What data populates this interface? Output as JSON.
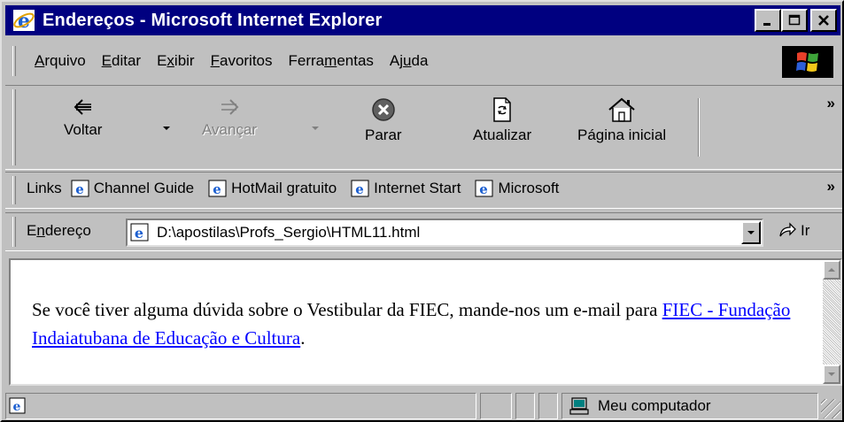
{
  "window": {
    "title": "Endereços - Microsoft Internet Explorer",
    "controls": {
      "minimize": "_",
      "maximize": "□",
      "close": "×"
    }
  },
  "menu": [
    {
      "pre": "",
      "key": "A",
      "post": "rquivo"
    },
    {
      "pre": "",
      "key": "E",
      "post": "ditar"
    },
    {
      "pre": "E",
      "key": "x",
      "post": "ibir"
    },
    {
      "pre": "",
      "key": "F",
      "post": "avoritos"
    },
    {
      "pre": "Ferra",
      "key": "m",
      "post": "entas"
    },
    {
      "pre": "Aj",
      "key": "u",
      "post": "da"
    }
  ],
  "toolbar": {
    "back_label": "Voltar",
    "forward_label": "Avançar",
    "stop_label": "Parar",
    "refresh_label": "Atualizar",
    "home_label": "Página inicial",
    "more": "»"
  },
  "links": {
    "label": "Links",
    "items": [
      "Channel Guide",
      "HotMail gratuito",
      "Internet Start",
      "Microsoft"
    ],
    "more": "»"
  },
  "address": {
    "label_pre": "E",
    "label_key": "n",
    "label_post": "dereço",
    "value": "D:\\apostilas\\Profs_Sergio\\HTML11.html",
    "go_label": "Ir"
  },
  "page": {
    "text_before": "Se você tiver alguma dúvida sobre o Vestibular da FIEC, mande-nos um e-mail para ",
    "link_text": "FIEC - Fundação Indaiatubana de Educação e Cultura",
    "text_after": "."
  },
  "status": {
    "zone": "Meu computador"
  },
  "colors": {
    "titlebar": "#000080",
    "face": "#c0c0c0",
    "link": "#0000ff",
    "ie_blue": "#1c5fd0"
  }
}
